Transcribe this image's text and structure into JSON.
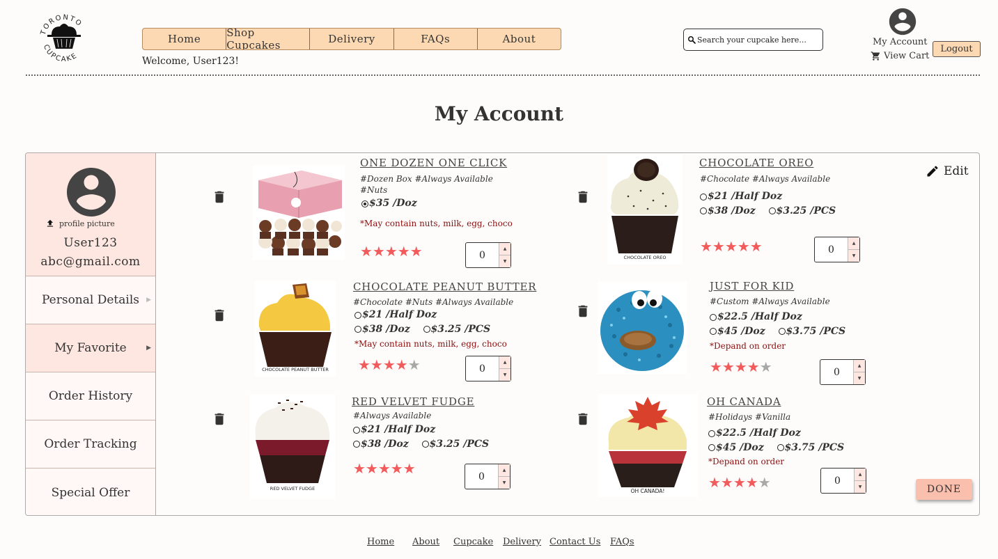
{
  "header": {
    "logo_alt": "TORONTO CUPCAKE",
    "nav": [
      "Home",
      "Shop Cupcakes",
      "Delivery",
      "FAQs",
      "About"
    ],
    "welcome": "Welcome, User123!",
    "search_placeholder": "Search your cupcake here...",
    "my_account": "My Account",
    "view_cart": "View Cart",
    "logout": "Logout"
  },
  "page_title": "My Account",
  "sidebar": {
    "upload_label": "profile picture",
    "username": "User123",
    "email": "abc@gmail.com",
    "items": [
      "Personal Details",
      "My Favorite",
      "Order History",
      "Order Tracking",
      "Special Offer"
    ],
    "active_item": "My Favorite"
  },
  "edit_label": "Edit",
  "favorites": [
    {
      "name": "ONE DOZEN ONE CLICK",
      "tags": "#Dozen Box #Always Available #Nuts",
      "options": [
        "$35 /Doz"
      ],
      "selected_option": 0,
      "note": "*May contain nuts, milk, egg, choco",
      "rating": 5,
      "quantity": "0",
      "image_icon": "cupcake-box-photo"
    },
    {
      "name": "CHOCOLATE OREO",
      "tags": "#Chocolate #Always Available",
      "options": [
        "$21 /Half Doz",
        "$38 /Doz",
        "$3.25 /PCS"
      ],
      "selected_option": -1,
      "note": "",
      "rating": 5,
      "quantity": "0",
      "image_label": "CHOCOLATE OREO"
    },
    {
      "name": "CHOCOLATE PEANUT BUTTER",
      "tags": "#Chocolate #Nuts #Always Available",
      "options": [
        "$21 /Half Doz",
        "$38 /Doz",
        "$3.25 /PCS"
      ],
      "selected_option": -1,
      "note": "*May contain nuts, milk, egg, choco",
      "rating": 4,
      "quantity": "0",
      "image_label": "CHOCOLATE PEANUT BUTTER"
    },
    {
      "name": "JUST FOR KID",
      "tags": "#Custom #Always Available",
      "options": [
        "$22.5 /Half Doz",
        "$45 /Doz",
        "$3.75 /PCS"
      ],
      "selected_option": -1,
      "note": "*Depand on order",
      "rating": 4,
      "quantity": "0"
    },
    {
      "name": "RED VELVET FUDGE",
      "tags": "#Always Available",
      "options": [
        "$21 /Half Doz",
        "$38 /Doz",
        "$3.25 /PCS"
      ],
      "selected_option": -1,
      "note": "",
      "rating": 5,
      "quantity": "0",
      "image_label": "RED VELVET FUDGE"
    },
    {
      "name": "OH CANADA",
      "tags": "#Holidays #Vanilla",
      "options": [
        "$22.5 /Half Doz",
        "$45 /Doz",
        "$3.75 /PCS"
      ],
      "selected_option": -1,
      "note": "*Depand on order",
      "rating": 4,
      "quantity": "0",
      "image_label": "OH CANADA!"
    }
  ],
  "done_label": "DONE",
  "footer": [
    "Home",
    "About",
    "Cupcake",
    "Delivery",
    "Contact Us",
    "FAQs"
  ],
  "colors": {
    "nav_bg": "#fcd9b3",
    "sidebar_bg": "#fde7e0",
    "star_on": "#f25b5b",
    "star_off": "#a8a8a8",
    "note": "#8b1010",
    "done_bg": "#fbbfae"
  }
}
